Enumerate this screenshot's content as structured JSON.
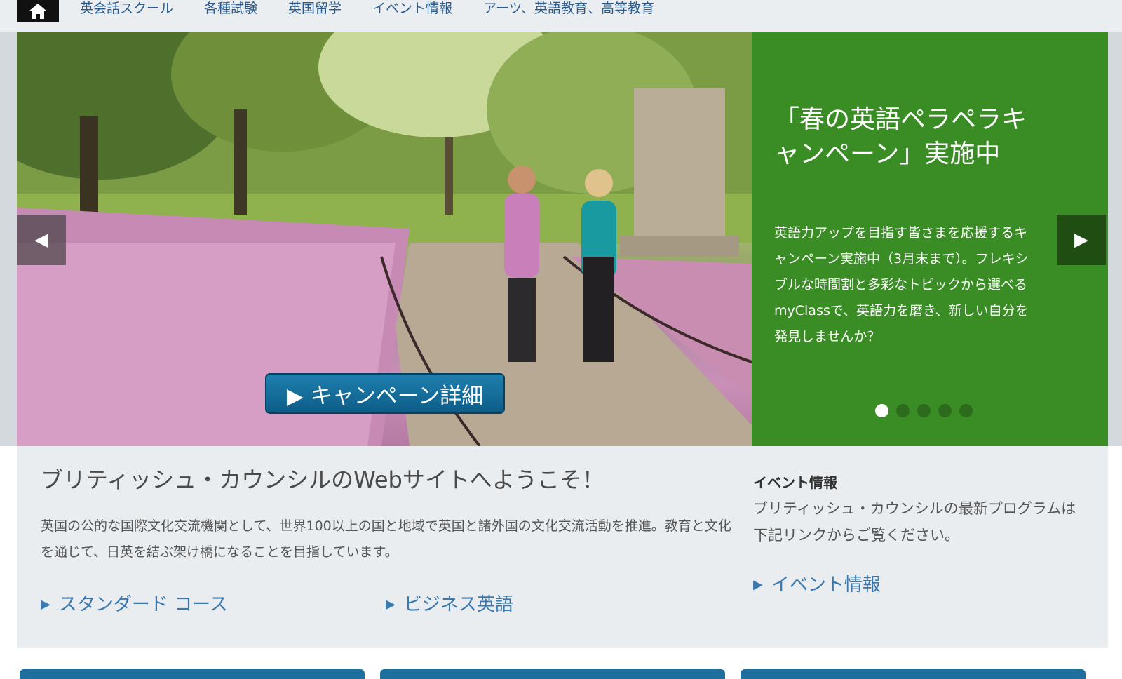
{
  "nav": {
    "home_icon": "home-icon",
    "items": [
      {
        "label": "英会話スクール"
      },
      {
        "label": "各種試験"
      },
      {
        "label": "英国留学"
      },
      {
        "label": "イベント情報"
      },
      {
        "label": "アーツ、英語教育、高等教育"
      }
    ]
  },
  "hero": {
    "prev_arrow": "◀",
    "next_arrow": "▶",
    "button_label": "▶ キャンペーン詳細",
    "panel": {
      "title": "「春の英語ペラペラキャンペーン」実施中",
      "text": "英語力アップを目指す皆さまを応援するキャンペーン実施中（3月末まで）。フレキシブルな時間割と多彩なトピックから選べるmyClassで、英語力を磨き、新しい自分を発見しませんか？"
    },
    "slides": {
      "count": 5,
      "active_index": 0
    }
  },
  "info": {
    "welcome_title": "ブリティッシュ・カウンシルのWebサイトへようこそ！",
    "welcome_text": "英国の公的な国際文化交流機関として、世界100以上の国と地域で英国と諸外国の文化交流活動を推進。教育と文化を通じて、日英を結ぶ架け橋になることを目指しています。",
    "links": {
      "standard": "スタンダード コース",
      "business": "ビジネス英語"
    },
    "event": {
      "heading": "イベント情報",
      "text": "ブリティッシュ・カウンシルの最新プログラムは下記リンクからご覧ください。",
      "link": "イベント情報"
    }
  },
  "colors": {
    "nav_bg": "#eaeef1",
    "nav_link": "#2a5a8e",
    "panel_green": "#3a8d24",
    "button_blue": "#0d5d88",
    "info_bg": "#e9edf0",
    "link_blue": "#3a78b0"
  }
}
